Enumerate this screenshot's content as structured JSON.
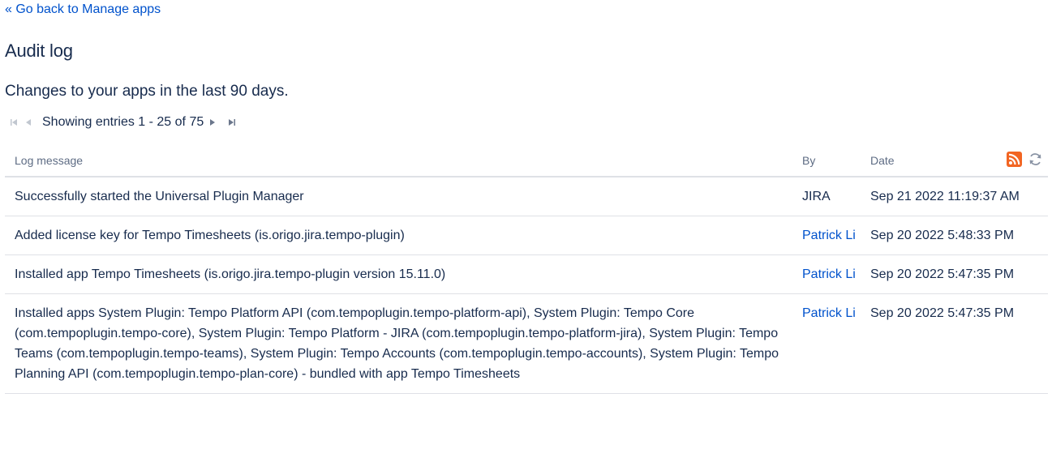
{
  "nav": {
    "back_link": "« Go back to Manage apps"
  },
  "page": {
    "title": "Audit log",
    "subtitle": "Changes to your apps in the last 90 days."
  },
  "pager": {
    "text": "Showing entries 1 - 25 of 75",
    "icons": [
      "first-page-icon",
      "previous-page-icon",
      "next-page-icon",
      "last-page-icon"
    ]
  },
  "table": {
    "headers": {
      "message": "Log message",
      "by": "By",
      "date": "Date"
    },
    "header_icons": [
      "rss-feed-icon",
      "refresh-icon"
    ],
    "rows": [
      {
        "message": "Successfully started the Universal Plugin Manager",
        "by": "JIRA",
        "by_is_link": false,
        "date": "Sep 21 2022 11:19:37 AM"
      },
      {
        "message": "Added license key for Tempo Timesheets (is.origo.jira.tempo-plugin)",
        "by": "Patrick Li",
        "by_is_link": true,
        "date": "Sep 20 2022 5:48:33 PM"
      },
      {
        "message": "Installed app Tempo Timesheets (is.origo.jira.tempo-plugin version 15.11.0)",
        "by": "Patrick Li",
        "by_is_link": true,
        "date": "Sep 20 2022 5:47:35 PM"
      },
      {
        "message": "Installed apps System Plugin: Tempo Platform API (com.tempoplugin.tempo-platform-api), System Plugin: Tempo Core (com.tempoplugin.tempo-core), System Plugin: Tempo Platform - JIRA (com.tempoplugin.tempo-platform-jira), System Plugin: Tempo Teams (com.tempoplugin.tempo-teams), System Plugin: Tempo Accounts (com.tempoplugin.tempo-accounts), System Plugin: Tempo Planning API (com.tempoplugin.tempo-plan-core) - bundled with app Tempo Timesheets",
        "by": "Patrick Li",
        "by_is_link": true,
        "date": "Sep 20 2022 5:47:35 PM"
      }
    ]
  },
  "colors": {
    "link": "#0052cc",
    "text": "#172b4d",
    "header_text": "#5e6c84",
    "border": "#dfe1e6",
    "rss": "#f26522"
  }
}
